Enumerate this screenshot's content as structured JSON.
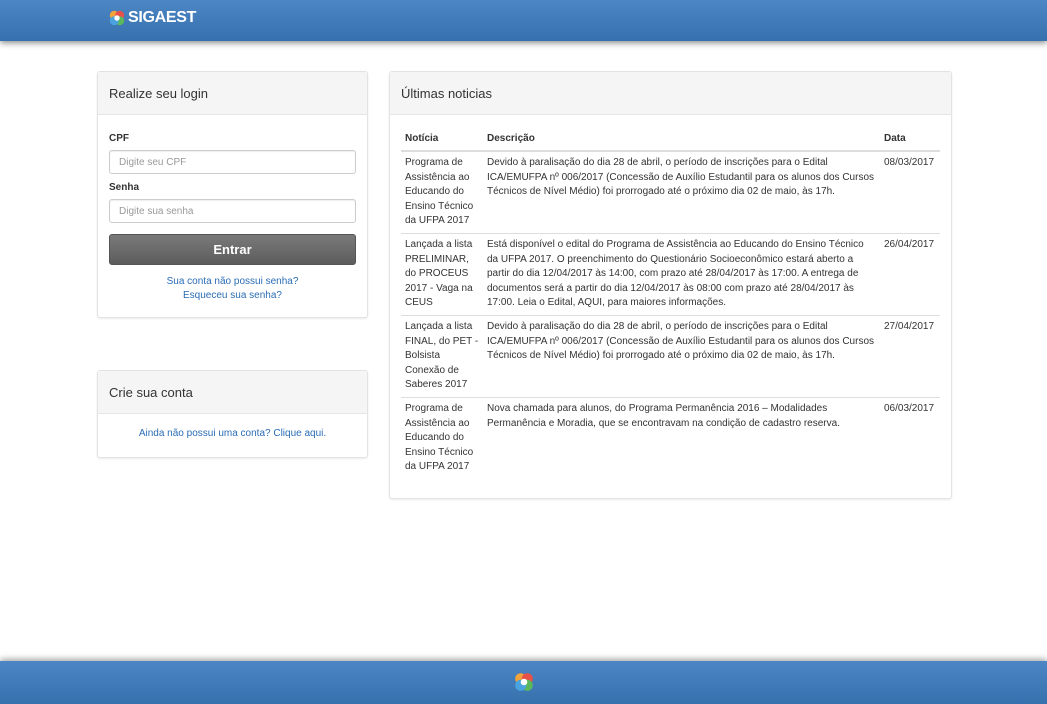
{
  "header": {
    "brand": "SIGAEST",
    "logo_icon": "pinwheel-logo-icon"
  },
  "login": {
    "title": "Realize seu login",
    "cpf_label": "CPF",
    "cpf_placeholder": "Digite seu CPF",
    "password_label": "Senha",
    "password_placeholder": "Digite sua senha",
    "submit_label": "Entrar",
    "no_password_link": "Sua conta não possui senha?",
    "forgot_link": "Esqueceu sua senha?"
  },
  "account": {
    "title": "Crie sua conta",
    "create_link": "Ainda não possui uma conta? Clique aqui."
  },
  "news": {
    "title": "Últimas noticias",
    "columns": [
      "Notícia",
      "Descrição",
      "Data"
    ],
    "rows": [
      {
        "title": "Programa de Assistência ao Educando do Ensino Técnico da UFPA 2017",
        "description": "Devido à paralisação do dia 28 de abril, o período de inscrições para o Edital ICA/EMUFPA nº 006/2017 (Concessão de Auxílio Estudantil para os alunos dos Cursos Técnicos de Nível Médio) foi prorrogado até o próximo dia 02 de maio, às 17h.",
        "date": "08/03/2017"
      },
      {
        "title": "Lançada a lista PRELIMINAR, do PROCEUS 2017 - Vaga na CEUS",
        "description": "Está disponível o edital do Programa de Assistência ao Educando do Ensino Técnico da UFPA 2017. O preenchimento do Questionário Socioeconômico estará aberto a partir do dia 12/04/2017 às 14:00, com prazo até 28/04/2017 às 17:00. A entrega de documentos será a partir do dia 12/04/2017 às 08:00 com prazo até 28/04/2017 às 17:00. Leia o Edital, AQUI, para maiores informações.",
        "date": "26/04/2017"
      },
      {
        "title": "Lançada a lista FINAL, do PET - Bolsista Conexão de Saberes 2017",
        "description": "Devido à paralisação do dia 28 de abril, o período de inscrições para o Edital ICA/EMUFPA nº 006/2017 (Concessão de Auxílio Estudantil para os alunos dos Cursos Técnicos de Nível Médio) foi prorrogado até o próximo dia 02 de maio, às 17h.",
        "date": "27/04/2017"
      },
      {
        "title": "Programa de Assistência ao Educando do Ensino Técnico da UFPA 2017",
        "description": "Nova chamada para alunos, do Programa Permanência 2016 – Modalidades Permanência e Moradia, que se encontravam na condição de cadastro reserva.",
        "date": "06/03/2017"
      }
    ]
  },
  "footer": {
    "logo_icon": "pinwheel-logo-icon"
  },
  "colors": {
    "header_blue": "#4277b8",
    "link_blue": "#2a6cb5",
    "button_gray": "#6b6b6b"
  }
}
